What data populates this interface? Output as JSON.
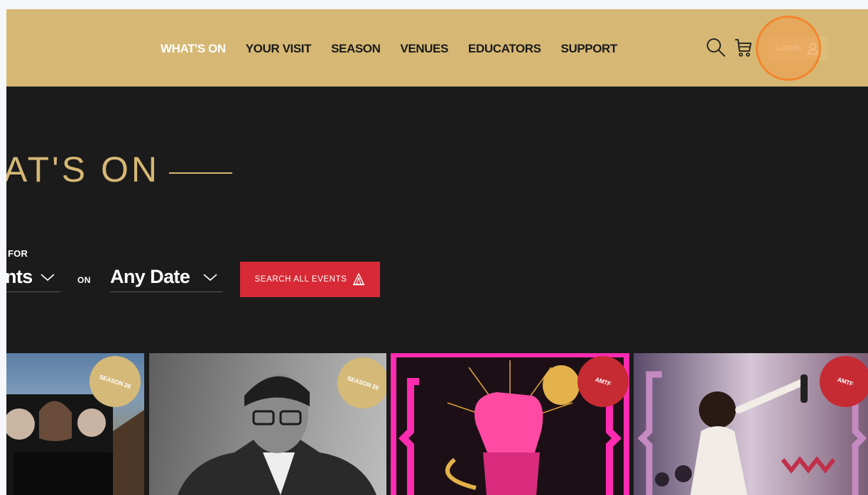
{
  "nav": {
    "items": [
      {
        "label": "WHAT'S ON",
        "active": true
      },
      {
        "label": "YOUR VISIT",
        "active": false
      },
      {
        "label": "SEASON",
        "active": false
      },
      {
        "label": "VENUES",
        "active": false
      },
      {
        "label": "EDUCATORS",
        "active": false
      },
      {
        "label": "SUPPORT",
        "active": false
      }
    ],
    "login_label": "LOGIN",
    "icons": [
      "search-icon",
      "cart-icon",
      "user-icon"
    ]
  },
  "hero": {
    "title": "AT'S ON"
  },
  "filter": {
    "for_label": "FOR",
    "events_value": "nts",
    "on_label": "ON",
    "date_value": "Any Date",
    "search_button_label": "SEARCH ALL EVENTS",
    "search_button_icon": "tent-icon"
  },
  "cards": [
    {
      "badge": "SEASON 26",
      "badge_color": "#d4b978"
    },
    {
      "badge": "SEASON 26",
      "badge_color": "#d4b978"
    },
    {
      "badge": "AMTF",
      "badge_color": "#c62a33"
    },
    {
      "badge": "AMTF",
      "badge_color": "#c62a33"
    }
  ],
  "colors": {
    "header_bg": "#d6b874",
    "page_bg": "#1b1b1b",
    "accent_gold": "#d6b874",
    "accent_red": "#d72a36"
  }
}
